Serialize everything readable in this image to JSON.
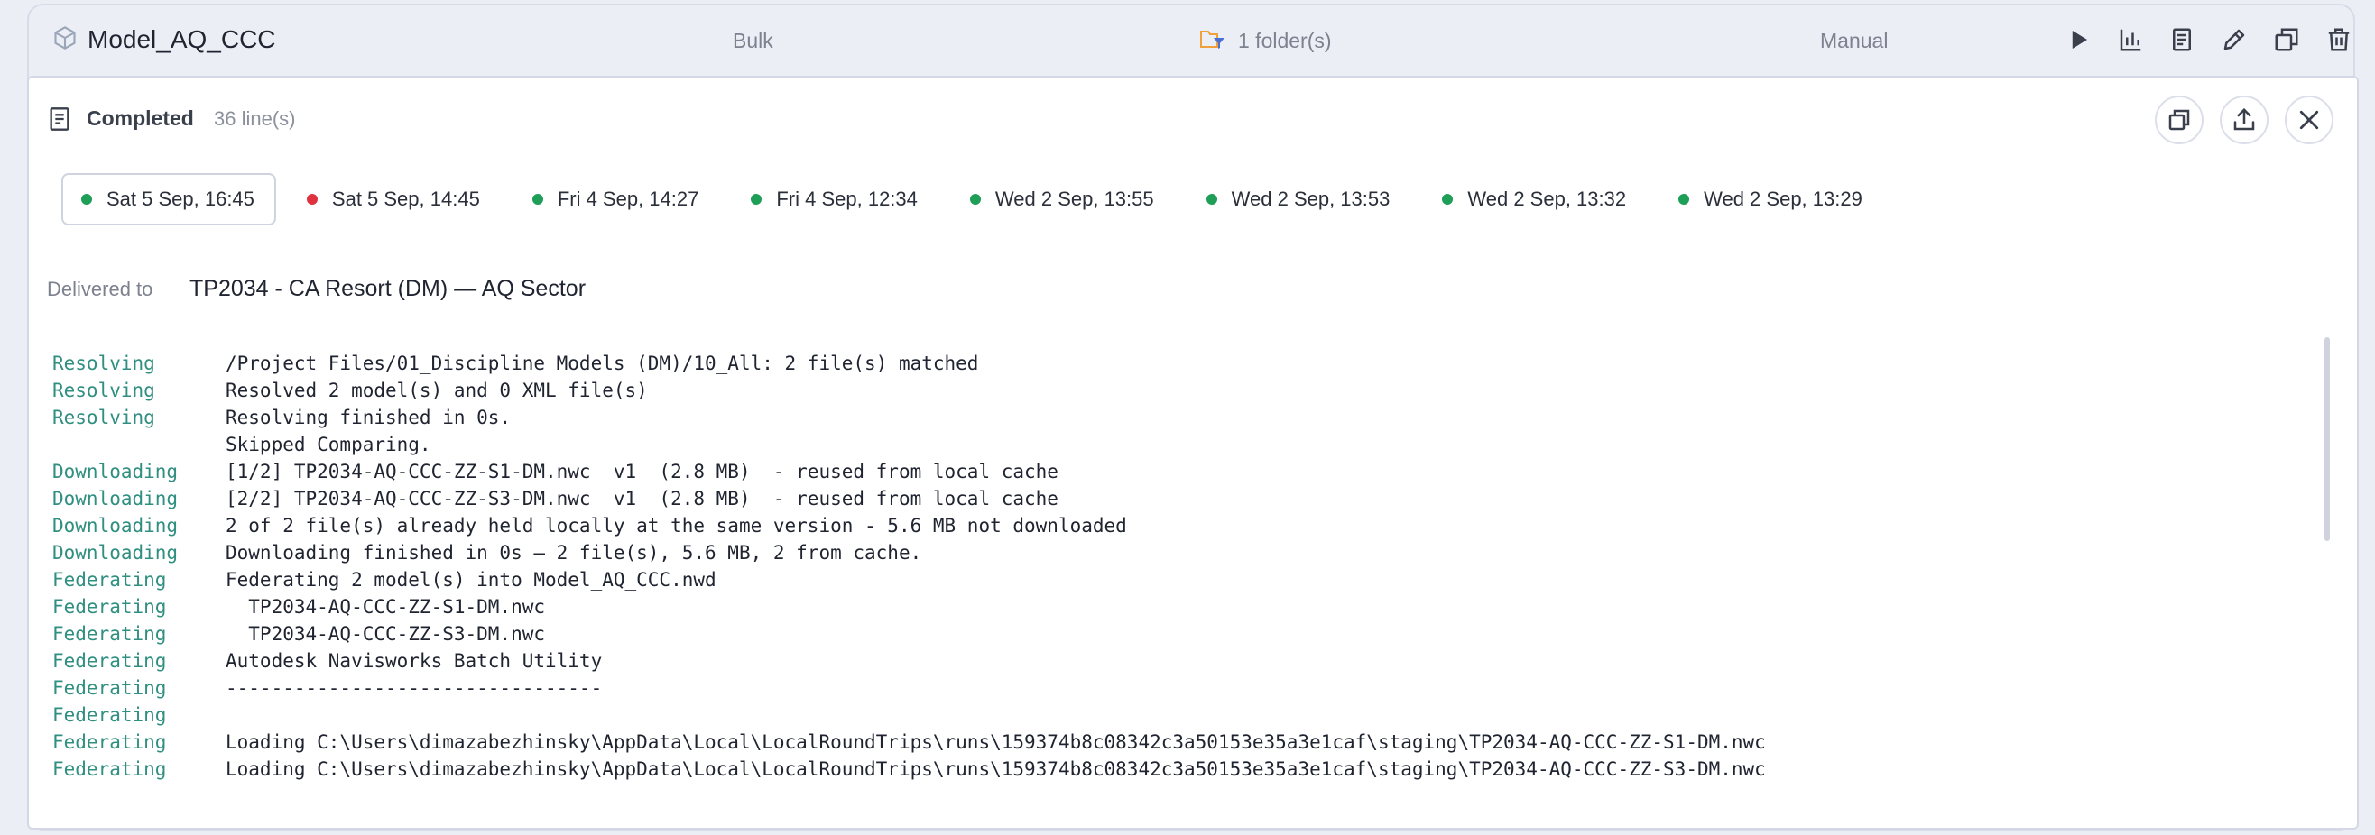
{
  "job": {
    "name": "Model_AQ_CCC",
    "mode": "Bulk",
    "folders": "1 folder(s)",
    "trigger": "Manual",
    "icons": [
      "cube-icon",
      "folder-filter-icon",
      "play-icon",
      "chart-icon",
      "report-icon",
      "edit-icon",
      "duplicate-icon",
      "trash-icon"
    ]
  },
  "panel": {
    "status": "Completed",
    "line_count": "36 line(s)",
    "actions": [
      "copy-icon",
      "upload-icon",
      "close-icon"
    ]
  },
  "runs": [
    {
      "label": "Sat 5 Sep, 16:45",
      "status": "success",
      "selected": true
    },
    {
      "label": "Sat 5 Sep, 14:45",
      "status": "failed",
      "selected": false
    },
    {
      "label": "Fri 4 Sep, 14:27",
      "status": "success",
      "selected": false
    },
    {
      "label": "Fri 4 Sep, 12:34",
      "status": "success",
      "selected": false
    },
    {
      "label": "Wed 2 Sep, 13:55",
      "status": "success",
      "selected": false
    },
    {
      "label": "Wed 2 Sep, 13:53",
      "status": "success",
      "selected": false
    },
    {
      "label": "Wed 2 Sep, 13:32",
      "status": "success",
      "selected": false
    },
    {
      "label": "Wed 2 Sep, 13:29",
      "status": "success",
      "selected": false
    }
  ],
  "colors": {
    "success": "#1e9e56",
    "failed": "#e0313f",
    "stage": "#2f8f80"
  },
  "delivery": {
    "label": "Delivered to",
    "target": "TP2034 - CA Resort (DM) — AQ Sector"
  },
  "log": [
    {
      "stage": "Resolving",
      "message": "/Project Files/01_Discipline Models (DM)/10_All: 2 file(s) matched"
    },
    {
      "stage": "Resolving",
      "message": "Resolved 2 model(s) and 0 XML file(s)"
    },
    {
      "stage": "Resolving",
      "message": "Resolving finished in 0s."
    },
    {
      "stage": "",
      "message": "Skipped Comparing."
    },
    {
      "stage": "Downloading",
      "message": "[1/2] TP2034-AQ-CCC-ZZ-S1-DM.nwc  v1  (2.8 MB)  - reused from local cache"
    },
    {
      "stage": "Downloading",
      "message": "[2/2] TP2034-AQ-CCC-ZZ-S3-DM.nwc  v1  (2.8 MB)  - reused from local cache"
    },
    {
      "stage": "Downloading",
      "message": "2 of 2 file(s) already held locally at the same version - 5.6 MB not downloaded"
    },
    {
      "stage": "Downloading",
      "message": "Downloading finished in 0s — 2 file(s), 5.6 MB, 2 from cache."
    },
    {
      "stage": "Federating",
      "message": "Federating 2 model(s) into Model_AQ_CCC.nwd"
    },
    {
      "stage": "Federating",
      "message": "  TP2034-AQ-CCC-ZZ-S1-DM.nwc"
    },
    {
      "stage": "Federating",
      "message": "  TP2034-AQ-CCC-ZZ-S3-DM.nwc"
    },
    {
      "stage": "Federating",
      "message": "Autodesk Navisworks Batch Utility"
    },
    {
      "stage": "Federating",
      "message": "---------------------------------"
    },
    {
      "stage": "Federating",
      "message": ""
    },
    {
      "stage": "Federating",
      "message": "Loading C:\\Users\\dimazabezhinsky\\AppData\\Local\\LocalRoundTrips\\runs\\159374b8c08342c3a50153e35a3e1caf\\staging\\TP2034-AQ-CCC-ZZ-S1-DM.nwc"
    },
    {
      "stage": "Federating",
      "message": "Loading C:\\Users\\dimazabezhinsky\\AppData\\Local\\LocalRoundTrips\\runs\\159374b8c08342c3a50153e35a3e1caf\\staging\\TP2034-AQ-CCC-ZZ-S3-DM.nwc"
    }
  ]
}
